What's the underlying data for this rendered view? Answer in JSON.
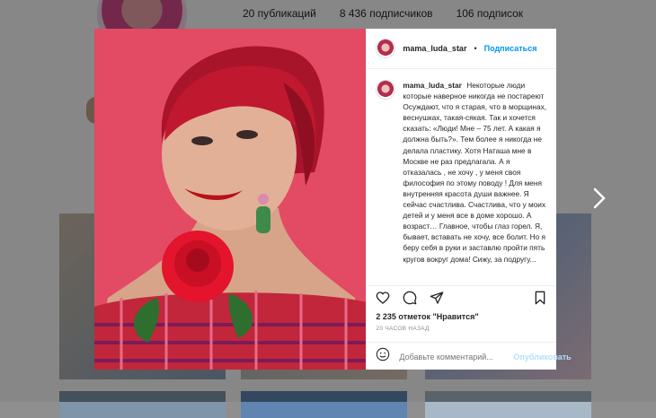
{
  "profile": {
    "stats": {
      "posts": "20 публикаций",
      "followers": "8 436 подписчиков",
      "following": "106 подписок"
    }
  },
  "post": {
    "username": "mama_luda_star",
    "separator": "•",
    "follow_label": "Подписаться",
    "caption_user": "mama_luda_star",
    "caption_text": "Некоторые люди которые наверное никогда не постареют Осуждают, что я старая, что в морщинах, веснушках, такая-сякая. Так и хочется сказать: «Люди! Мне – 75 лет. А какая я должна быть?». Тем более я никогда не делала пластику. Хотя Наташа мне в Москве не раз предлагала. А я отказалась , не хочу , у меня своя философия по этому поводу ! Для меня внутренняя красота души важнее. Я сейчас счастлива. Счастлива, что у моих детей и у меня все в доме хорошо. А возраст… Главное, чтобы глаз горел. Я, бывает, вставать не хочу, все болит. Но я беру себя в руки и заставлю пройти пять кругов вокруг дома! Сижу, за подругу...",
    "likes": "2 235 отметок \"Нравится\"",
    "time": "20 ЧАСОВ НАЗАД",
    "comment_placeholder": "Добавьте комментарий...",
    "publish_label": "Опубликовать"
  },
  "icons": {
    "like": "heart-icon",
    "comment": "comment-icon",
    "share": "share-icon",
    "save": "bookmark-icon",
    "emoji": "emoji-icon",
    "next": "chevron-right-icon"
  },
  "colors": {
    "accent": "#0095f6",
    "photo_background": "#e34a63",
    "hair": "#b3172c"
  }
}
